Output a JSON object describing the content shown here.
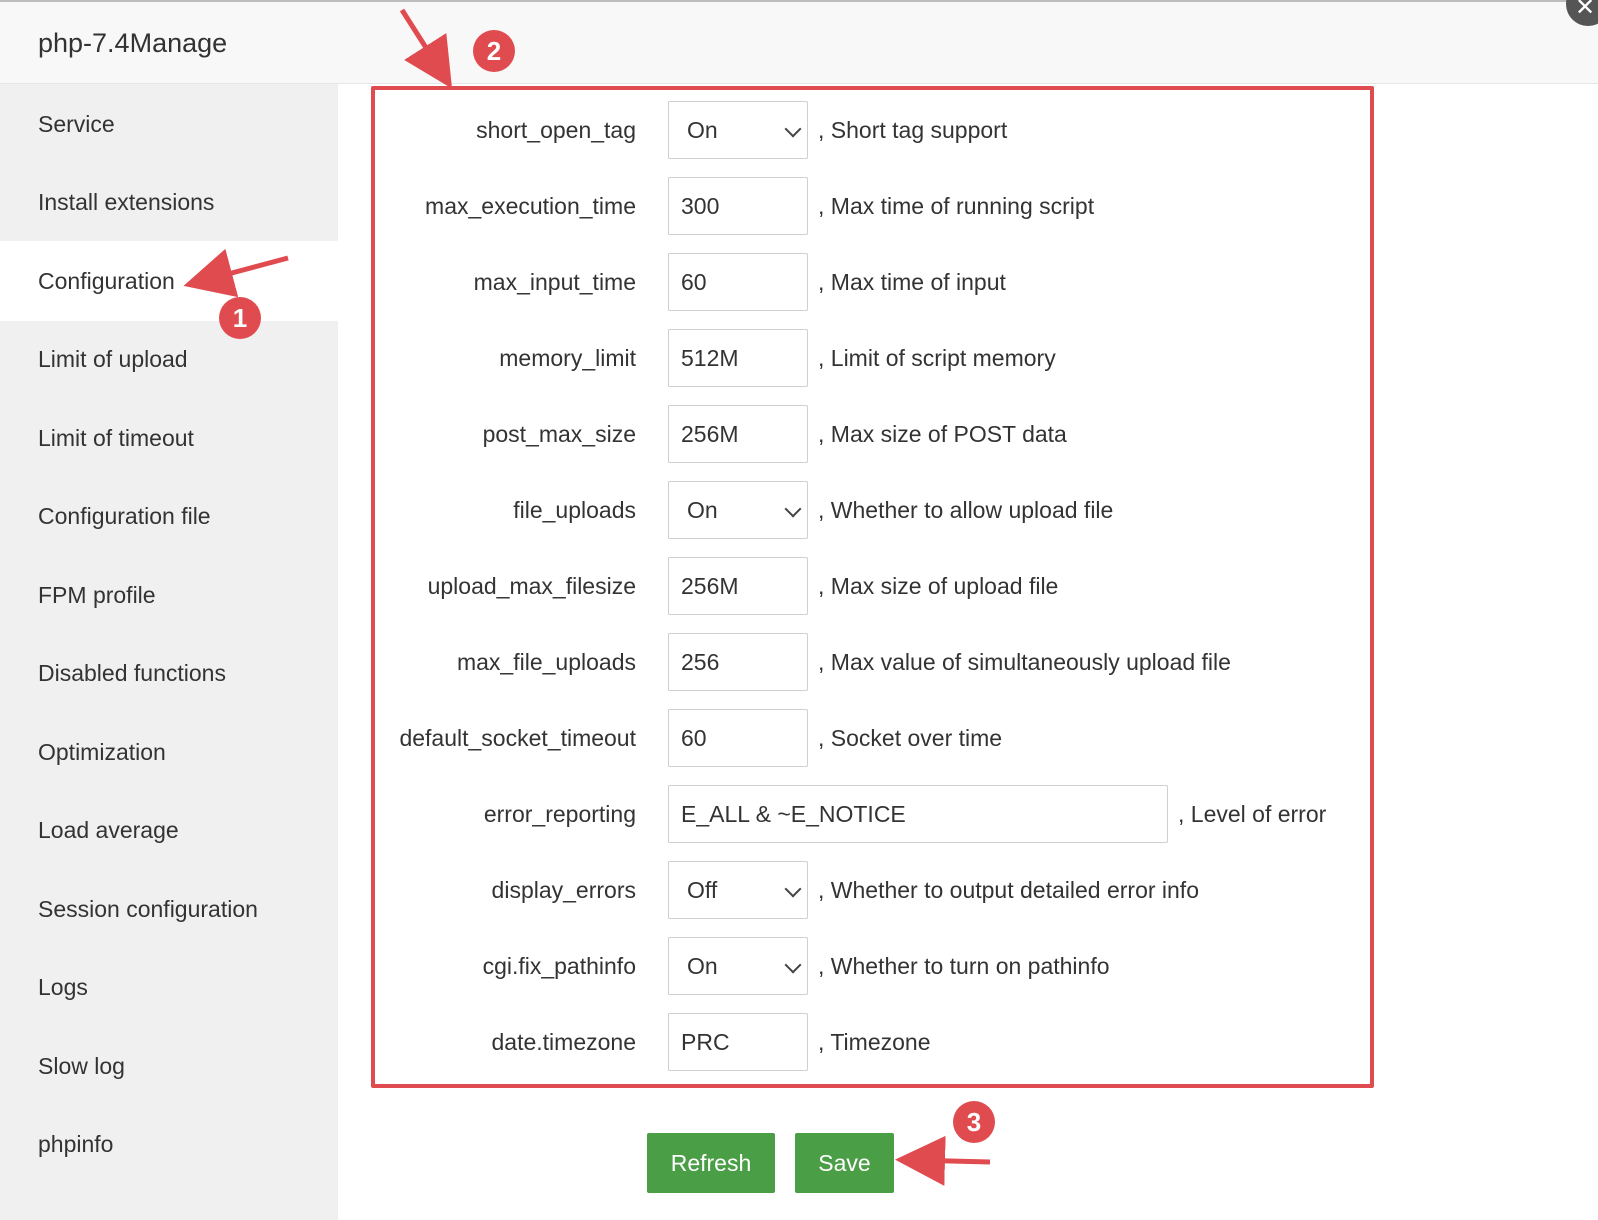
{
  "dialog": {
    "title": "php-7.4Manage",
    "close_icon": "close-icon"
  },
  "sidebar": {
    "items": [
      {
        "label": "Service"
      },
      {
        "label": "Install extensions"
      },
      {
        "label": "Configuration",
        "active": true
      },
      {
        "label": "Limit of upload"
      },
      {
        "label": "Limit of timeout"
      },
      {
        "label": "Configuration file"
      },
      {
        "label": "FPM profile"
      },
      {
        "label": "Disabled functions"
      },
      {
        "label": "Optimization"
      },
      {
        "label": "Load average"
      },
      {
        "label": "Session configuration"
      },
      {
        "label": "Logs"
      },
      {
        "label": "Slow log"
      },
      {
        "label": "phpinfo"
      }
    ]
  },
  "config": {
    "rows": [
      {
        "name": "short_open_tag",
        "type": "select",
        "value": "On",
        "desc": ", Short tag support"
      },
      {
        "name": "max_execution_time",
        "type": "input",
        "value": "300",
        "desc": ", Max time of running script"
      },
      {
        "name": "max_input_time",
        "type": "input",
        "value": "60",
        "desc": ", Max time of input"
      },
      {
        "name": "memory_limit",
        "type": "input",
        "value": "512M",
        "desc": ", Limit of script memory"
      },
      {
        "name": "post_max_size",
        "type": "input",
        "value": "256M",
        "desc": ", Max size of POST data"
      },
      {
        "name": "file_uploads",
        "type": "select",
        "value": "On",
        "desc": ", Whether to allow upload file"
      },
      {
        "name": "upload_max_filesize",
        "type": "input",
        "value": "256M",
        "desc": ", Max size of upload file"
      },
      {
        "name": "max_file_uploads",
        "type": "input",
        "value": "256",
        "desc": ", Max value of simultaneously upload file"
      },
      {
        "name": "default_socket_timeout",
        "type": "input",
        "value": "60",
        "desc": ", Socket over time"
      },
      {
        "name": "error_reporting",
        "type": "wide",
        "value": "E_ALL & ~E_NOTICE",
        "desc": ", Level of error"
      },
      {
        "name": "display_errors",
        "type": "select",
        "value": "Off",
        "desc": ", Whether to output detailed error info"
      },
      {
        "name": "cgi.fix_pathinfo",
        "type": "select",
        "value": "On",
        "desc": ", Whether to turn on pathinfo"
      },
      {
        "name": "date.timezone",
        "type": "input",
        "value": "PRC",
        "desc": ", Timezone"
      }
    ]
  },
  "buttons": {
    "refresh": "Refresh",
    "save": "Save"
  },
  "annotations": {
    "badge1": "1",
    "badge2": "2",
    "badge3": "3"
  },
  "colors": {
    "accent_green": "#4a9e46",
    "annotation_red": "#e04b4f",
    "sidebar_bg": "#f0f0f0"
  }
}
